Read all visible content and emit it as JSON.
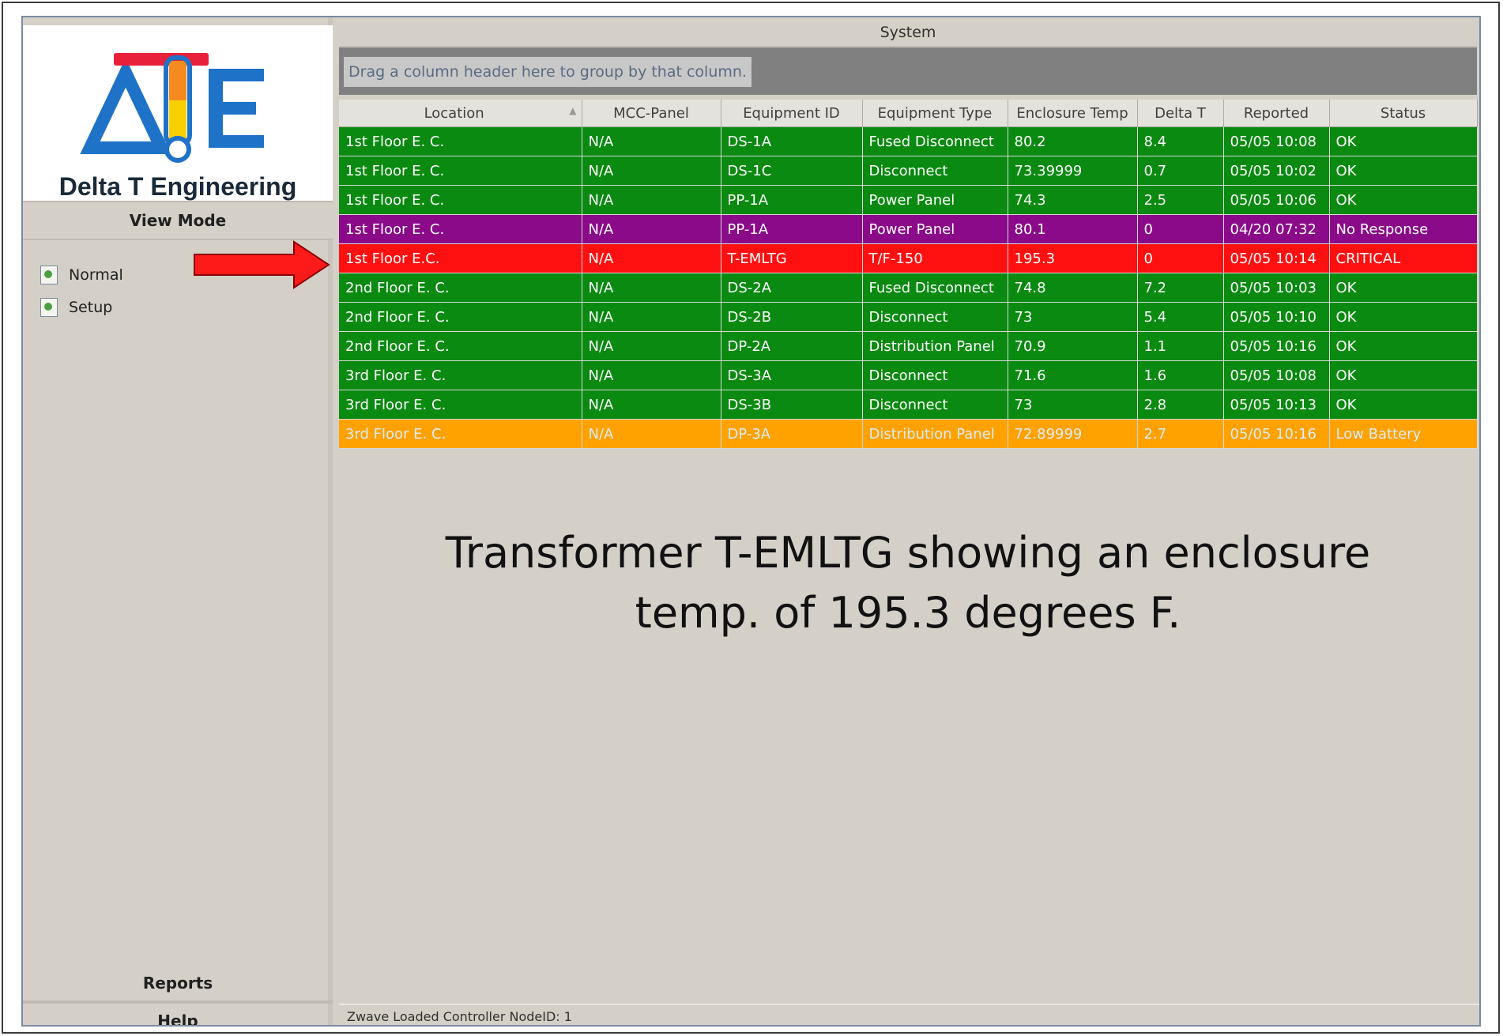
{
  "colors": {
    "ok": "#0a8a10",
    "no_response": "#8a0a8a",
    "critical": "#ff1010",
    "low_battery": "#ffa200",
    "logo_blue": "#1e72c8",
    "logo_red": "#e8203a",
    "logo_yellow": "#f8d000"
  },
  "sidebar": {
    "company_name": "Delta T Engineering",
    "view_mode_header": "View Mode",
    "items": [
      {
        "label": "Normal",
        "icon": "page-icon"
      },
      {
        "label": "Setup",
        "icon": "page-icon"
      }
    ],
    "reports_header": "Reports",
    "help_header": "Help"
  },
  "main": {
    "title": "System",
    "group_hint": "Drag a column header here to group by that column.",
    "columns": [
      "Location",
      "MCC-Panel",
      "Equipment ID",
      "Equipment Type",
      "Enclosure Temp",
      "Delta T",
      "Reported",
      "Status"
    ],
    "rows": [
      {
        "status_class": "ok",
        "cells": [
          "1st Floor E. C.",
          "N/A",
          "DS-1A",
          "Fused Disconnect",
          "80.2",
          "8.4",
          "05/05 10:08",
          "OK"
        ]
      },
      {
        "status_class": "ok",
        "cells": [
          "1st Floor E. C.",
          "N/A",
          "DS-1C",
          "Disconnect",
          "73.39999",
          "0.7",
          "05/05 10:02",
          "OK"
        ]
      },
      {
        "status_class": "ok",
        "cells": [
          "1st Floor E. C.",
          "N/A",
          "PP-1A",
          "Power Panel",
          "74.3",
          "2.5",
          "05/05 10:06",
          "OK"
        ]
      },
      {
        "status_class": "noresp",
        "cells": [
          "1st Floor E. C.",
          "N/A",
          "PP-1A",
          "Power Panel",
          "80.1",
          "0",
          "04/20 07:32",
          "No Response"
        ]
      },
      {
        "status_class": "critical",
        "cells": [
          "1st Floor E.C.",
          "N/A",
          "T-EMLTG",
          "T/F-150",
          "195.3",
          "0",
          "05/05 10:14",
          "CRITICAL"
        ]
      },
      {
        "status_class": "ok",
        "cells": [
          "2nd Floor E. C.",
          "N/A",
          "DS-2A",
          "Fused Disconnect",
          "74.8",
          "7.2",
          "05/05 10:03",
          "OK"
        ]
      },
      {
        "status_class": "ok",
        "cells": [
          "2nd Floor E. C.",
          "N/A",
          "DS-2B",
          "Disconnect",
          "73",
          "5.4",
          "05/05 10:10",
          "OK"
        ]
      },
      {
        "status_class": "ok",
        "cells": [
          "2nd Floor E. C.",
          "N/A",
          "DP-2A",
          "Distribution Panel",
          "70.9",
          "1.1",
          "05/05 10:16",
          "OK"
        ]
      },
      {
        "status_class": "ok",
        "cells": [
          "3rd Floor E. C.",
          "N/A",
          "DS-3A",
          "Disconnect",
          "71.6",
          "1.6",
          "05/05 10:08",
          "OK"
        ]
      },
      {
        "status_class": "ok",
        "cells": [
          "3rd Floor E. C.",
          "N/A",
          "DS-3B",
          "Disconnect",
          "73",
          "2.8",
          "05/05 10:13",
          "OK"
        ]
      },
      {
        "status_class": "lowbatt",
        "cells": [
          "3rd Floor E. C.",
          "N/A",
          "DP-3A",
          "Distribution Panel",
          "72.89999",
          "2.7",
          "05/05 10:16",
          "Low Battery"
        ]
      }
    ],
    "annotation_line1": "Transformer T-EMLTG showing an enclosure",
    "annotation_line2": "temp. of 195.3 degrees F."
  },
  "status_bar": {
    "text": "Zwave Loaded Controller NodeID: 1"
  }
}
